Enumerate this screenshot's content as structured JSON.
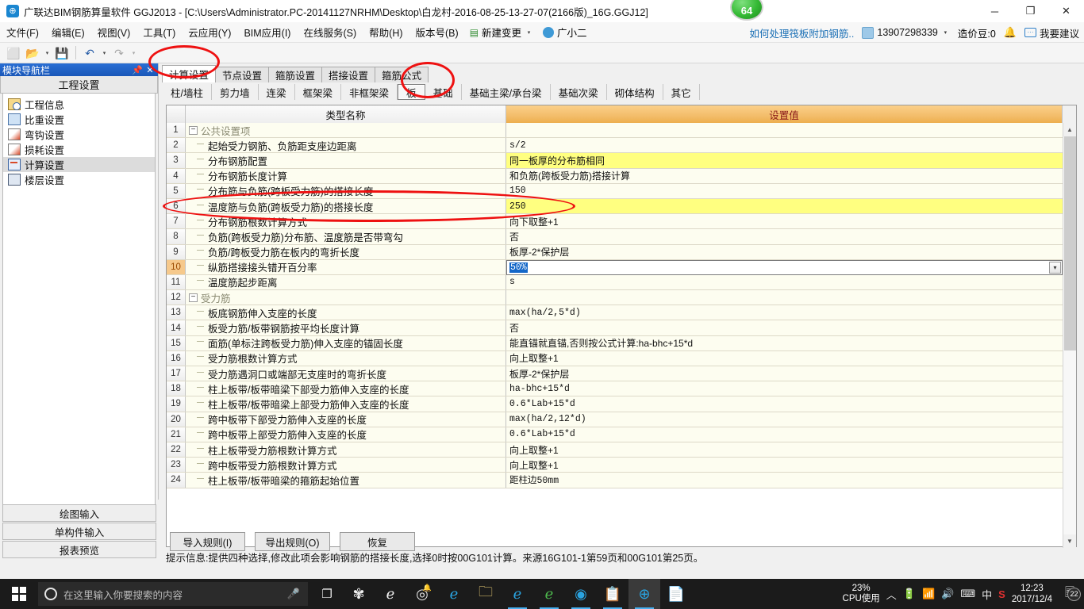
{
  "titlebar": {
    "app_title": "广联达BIM钢筋算量软件 GGJ2013 - [C:\\Users\\Administrator.PC-20141127NRHM\\Desktop\\白龙村-2016-08-25-13-27-07(2166版)_16G.GGJ12]",
    "badge": "64",
    "minimize": "─",
    "restore": "❐",
    "close": "✕"
  },
  "menubar": {
    "items": [
      "文件(F)",
      "编辑(E)",
      "视图(V)",
      "工具(T)",
      "云应用(Y)",
      "BIM应用(I)",
      "在线服务(S)",
      "帮助(H)",
      "版本号(B)"
    ],
    "new_change": "新建变更",
    "new_change_caret": "▾",
    "assistant": "广小二",
    "right": {
      "promo_link": "如何处理筏板附加钢筋..",
      "account": "13907298339",
      "account_caret": "▾",
      "coins": "造价豆:0",
      "suggest": "我要建议"
    }
  },
  "toolbar": {
    "buttons": [
      "new-file",
      "open-file",
      "save-file",
      "undo",
      "redo"
    ],
    "glyphs": {
      "new": "⬜",
      "open": "📂",
      "save": "💾",
      "undo": "↶",
      "redo": "↷",
      "caret": "▾"
    }
  },
  "navpanel": {
    "caption": "模块导航栏",
    "pin": "📌",
    "close": "✕",
    "group_title": "工程设置",
    "items": [
      {
        "label": "工程信息",
        "icon": "project-info-icon",
        "selected": false
      },
      {
        "label": "比重设置",
        "icon": "weight-settings-icon",
        "selected": false
      },
      {
        "label": "弯钩设置",
        "icon": "hook-settings-icon",
        "selected": false
      },
      {
        "label": "损耗设置",
        "icon": "loss-settings-icon",
        "selected": false
      },
      {
        "label": "计算设置",
        "icon": "calc-settings-icon",
        "selected": true
      },
      {
        "label": "楼层设置",
        "icon": "floor-settings-icon",
        "selected": false
      }
    ],
    "bottom_buttons": [
      "绘图输入",
      "单构件输入",
      "报表预览"
    ]
  },
  "content": {
    "tabs_primary": [
      {
        "label": "计算设置",
        "active": true
      },
      {
        "label": "节点设置",
        "active": false
      },
      {
        "label": "箍筋设置",
        "active": false
      },
      {
        "label": "搭接设置",
        "active": false
      },
      {
        "label": "箍筋公式",
        "active": false
      }
    ],
    "tabs_secondary": [
      {
        "label": "柱/墙柱",
        "active": false
      },
      {
        "label": "剪力墙",
        "active": false
      },
      {
        "label": "连梁",
        "active": false
      },
      {
        "label": "框架梁",
        "active": false
      },
      {
        "label": "非框架梁",
        "active": false
      },
      {
        "label": "板",
        "active": true
      },
      {
        "label": "基础",
        "active": false
      },
      {
        "label": "基础主梁/承台梁",
        "active": false
      },
      {
        "label": "基础次梁",
        "active": false
      },
      {
        "label": "砌体结构",
        "active": false
      },
      {
        "label": "其它",
        "active": false
      }
    ],
    "grid": {
      "headers": {
        "row_num": "",
        "name": "类型名称",
        "value": "设置值"
      },
      "rows": [
        {
          "n": "1",
          "kind": "group",
          "name": "公共设置项",
          "value": "",
          "bg": "group"
        },
        {
          "n": "2",
          "kind": "item",
          "name": "起始受力钢筋、负筋距支座边距离",
          "value": "s/2",
          "bg": "cream",
          "mono": true
        },
        {
          "n": "3",
          "kind": "item",
          "name": "分布钢筋配置",
          "value": "同一板厚的分布筋相同",
          "bg": "yellow"
        },
        {
          "n": "4",
          "kind": "item",
          "name": "分布钢筋长度计算",
          "value": "和负筋(跨板受力筋)搭接计算",
          "bg": "cream"
        },
        {
          "n": "5",
          "kind": "item",
          "name": "分布筋与负筋(跨板受力筋)的搭接长度",
          "value": "150",
          "bg": "cream",
          "mono": true
        },
        {
          "n": "6",
          "kind": "item",
          "name": "温度筋与负筋(跨板受力筋)的搭接长度",
          "value": "250",
          "bg": "yellow",
          "mono": true
        },
        {
          "n": "7",
          "kind": "item",
          "name": "分布钢筋根数计算方式",
          "value": "向下取整+1",
          "bg": "cream"
        },
        {
          "n": "8",
          "kind": "item",
          "name": "负筋(跨板受力筋)分布筋、温度筋是否带弯勾",
          "value": "否",
          "bg": "cream"
        },
        {
          "n": "9",
          "kind": "item",
          "name": "负筋/跨板受力筋在板内的弯折长度",
          "value": "板厚-2*保护层",
          "bg": "cream"
        },
        {
          "n": "10",
          "kind": "editor",
          "name": "纵筋搭接接头错开百分率",
          "value": "50%",
          "bg": "cream",
          "current": true
        },
        {
          "n": "11",
          "kind": "item",
          "name": "温度筋起步距离",
          "value": "s",
          "bg": "cream",
          "mono": true
        },
        {
          "n": "12",
          "kind": "group",
          "name": "受力筋",
          "value": "",
          "bg": "group"
        },
        {
          "n": "13",
          "kind": "item",
          "name": "板底钢筋伸入支座的长度",
          "value": "max(ha/2,5*d)",
          "bg": "cream",
          "mono": true
        },
        {
          "n": "14",
          "kind": "item",
          "name": "板受力筋/板带钢筋按平均长度计算",
          "value": "否",
          "bg": "cream"
        },
        {
          "n": "15",
          "kind": "item",
          "name": "面筋(单标注跨板受力筋)伸入支座的锚固长度",
          "value": "能直锚就直锚,否则按公式计算:ha-bhc+15*d",
          "bg": "cream"
        },
        {
          "n": "16",
          "kind": "item",
          "name": "受力筋根数计算方式",
          "value": "向上取整+1",
          "bg": "cream"
        },
        {
          "n": "17",
          "kind": "item",
          "name": "受力筋遇洞口或端部无支座时的弯折长度",
          "value": "板厚-2*保护层",
          "bg": "cream"
        },
        {
          "n": "18",
          "kind": "item",
          "name": "柱上板带/板带暗梁下部受力筋伸入支座的长度",
          "value": "ha-bhc+15*d",
          "bg": "cream",
          "mono": true
        },
        {
          "n": "19",
          "kind": "item",
          "name": "柱上板带/板带暗梁上部受力筋伸入支座的长度",
          "value": "0.6*Lab+15*d",
          "bg": "cream",
          "mono": true
        },
        {
          "n": "20",
          "kind": "item",
          "name": "跨中板带下部受力筋伸入支座的长度",
          "value": "max(ha/2,12*d)",
          "bg": "cream",
          "mono": true
        },
        {
          "n": "21",
          "kind": "item",
          "name": "跨中板带上部受力筋伸入支座的长度",
          "value": "0.6*Lab+15*d",
          "bg": "cream",
          "mono": true
        },
        {
          "n": "22",
          "kind": "item",
          "name": "柱上板带受力筋根数计算方式",
          "value": "向上取整+1",
          "bg": "cream"
        },
        {
          "n": "23",
          "kind": "item",
          "name": "跨中板带受力筋根数计算方式",
          "value": "向上取整+1",
          "bg": "cream"
        },
        {
          "n": "24",
          "kind": "item",
          "name": "柱上板带/板带暗梁的箍筋起始位置",
          "value": "距柱边50mm",
          "bg": "cream",
          "mono": true
        }
      ]
    },
    "tip": {
      "label": "提示信息:",
      "text": "提供四种选择,修改此项会影响钢筋的搭接长度,选择0时按00G101计算。来源16G101-1第59页和00G101第25页。"
    },
    "bottom_buttons": [
      "导入规则(I)",
      "导出规则(O)",
      "恢复"
    ]
  },
  "taskbar": {
    "search_placeholder": "在这里输入你要搜索的内容",
    "cpu_percent": "23%",
    "cpu_label": "CPU使用",
    "time": "12:23",
    "date": "2017/12/4",
    "ime": "中",
    "notification_count": "22",
    "items": [
      "task-view-icon",
      "app-fan-icon",
      "app-ie-classic-icon",
      "app-spiral-icon",
      "app-edge-icon",
      "app-folder-icon",
      "app-ie-icon",
      "app-ie-green-icon",
      "app-360-icon",
      "app-notes-icon",
      "app-ggj-icon",
      "app-help-icon"
    ]
  },
  "annotations": {
    "color": "#ee1111",
    "marks": [
      "ellipse-calc-settings-tab",
      "ellipse-ban-tab",
      "ellipse-row-6"
    ]
  }
}
